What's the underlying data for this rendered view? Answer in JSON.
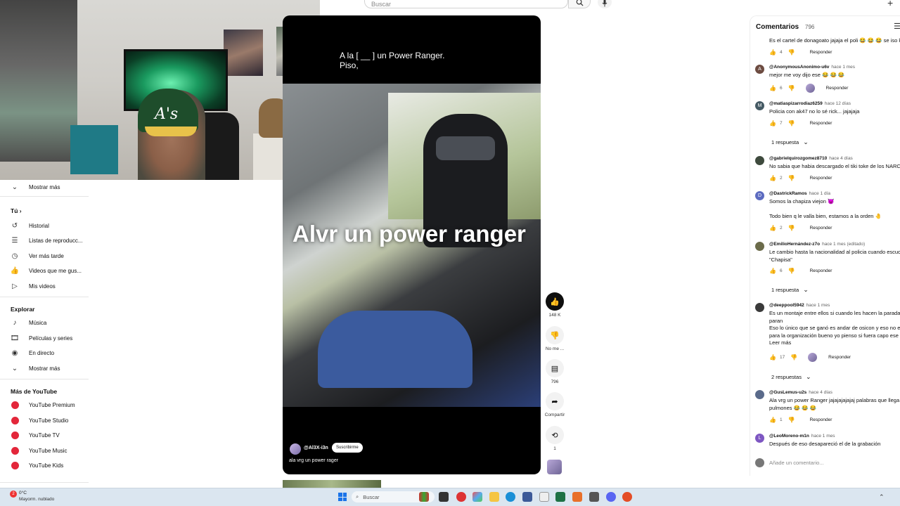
{
  "header": {
    "search_placeholder": "Buscar",
    "search_icon": "search-icon",
    "mic_icon": "mic-icon",
    "create_label": "+"
  },
  "webcam": {
    "cap_logo": "A's"
  },
  "sidebar": {
    "show_more_top": "Mostrar más",
    "you_heading": "Tú",
    "you_items": [
      {
        "label": "Historial",
        "icon": "history-icon"
      },
      {
        "label": "Listas de reproducc...",
        "icon": "playlists-icon"
      },
      {
        "label": "Ver más tarde",
        "icon": "watch-later-icon"
      },
      {
        "label": "Videos que me gus...",
        "icon": "liked-videos-icon"
      },
      {
        "label": "Mis videos",
        "icon": "my-videos-icon"
      }
    ],
    "explore_heading": "Explorar",
    "explore_items": [
      {
        "label": "Música",
        "icon": "music-icon"
      },
      {
        "label": "Películas y series",
        "icon": "movies-icon"
      },
      {
        "label": "En directo",
        "icon": "live-icon"
      },
      {
        "label": "Mostrar más",
        "icon": "chevron-down-icon"
      }
    ],
    "more_heading": "Más de YouTube",
    "more_items": [
      {
        "label": "YouTube Premium"
      },
      {
        "label": "YouTube Studio"
      },
      {
        "label": "YouTube TV"
      },
      {
        "label": "YouTube Music"
      },
      {
        "label": "YouTube Kids"
      }
    ]
  },
  "player": {
    "caption": "A la [ __ ] un Power Ranger.\nPiso,",
    "overlay_text": "Alvr  un power ranger",
    "channel": "@Al3X-i3n",
    "subscribe_label": "Suscribirme",
    "title": "ala vrg un power rager"
  },
  "actions": {
    "like_count": "148 K",
    "dislike_label": "No me ...",
    "comments_count": "796",
    "share_label": "Compartir",
    "remix_count": "1"
  },
  "comments": {
    "title": "Comentarios",
    "count": "796",
    "add_placeholder": "Añade un comentario...",
    "items": [
      {
        "author": "",
        "age": "",
        "text": "Es el cartel de donagoato jajaja el poli 😂 😂 😂 se iso k",
        "likes": "4",
        "hearted": false,
        "avatar_color": "#999"
      },
      {
        "author": "@AnonymousAnonimo-u6v",
        "age": "hace 1 mes",
        "text": "mejor me voy dijo ese 😂 😂 😂",
        "likes": "6",
        "hearted": true,
        "avatar_letter": "A",
        "avatar_color": "#6d4c41"
      },
      {
        "author": "@matiaspizarrodiaz6259",
        "age": "hace 12 días",
        "text": "Policia con ak47 no lo sé rick... jajajaja",
        "likes": "7",
        "hearted": false,
        "avatar_letter": "M",
        "avatar_color": "#455a64",
        "replies": "1 respuesta"
      },
      {
        "author": "@gabrielquirozgomez8710",
        "age": "hace 4 días",
        "text": "No sabia que habia descargado el tiki toke de los NARC",
        "likes": "2",
        "hearted": false,
        "avatar_color": "#3e4a3d"
      },
      {
        "author": "@DastrickRamos",
        "age": "hace 1 día",
        "text": "Somos la chapiza viejon 😈\n\nTodo bien q le valla bien, estamos a la orden 🤚",
        "likes": "2",
        "hearted": false,
        "avatar_letter": "D",
        "avatar_color": "#5c6bc0"
      },
      {
        "author": "@EmilioHernández-z7o",
        "age": "hace 1 mes (editado)",
        "text": "Le cambio hasta la nacionalidad al policia cuando escuc\n\"Chapisa\"",
        "likes": "6",
        "hearted": false,
        "avatar_color": "#6b6b4a",
        "replies": "1 respuesta"
      },
      {
        "author": "@deeppool5942",
        "age": "hace 1 mes",
        "text": "Es un montaje entre ellos si cuando les hacen la parada\nparan\nEso lo único que se ganó es andar de osicon y eso no es\npara la organización bueno yo pienso si fuera capo ese\nLeer más",
        "likes": "17",
        "hearted": true,
        "avatar_color": "#3a3a3a",
        "replies": "2 respuestas"
      },
      {
        "author": "@GusLemus-u2s",
        "age": "hace 4 días",
        "text": "Ala vrg un power Ranger jajajajajajaj palabras que llega\npulmones 😂 😂 😂",
        "likes": "1",
        "hearted": false,
        "avatar_color": "#5a6a8a"
      },
      {
        "author": "@LeoMoreno-m1n",
        "age": "hace 1 mes",
        "text": "Después de eso desapareció el de la grabación",
        "likes": "",
        "hearted": false,
        "avatar_letter": "L",
        "avatar_color": "#7e57c2"
      }
    ]
  },
  "comment_actions": {
    "reply_label": "Responder",
    "like_icon": "thumbs-up-icon",
    "dislike_icon": "thumbs-down-icon"
  },
  "taskbar": {
    "weather_badge": "2",
    "weather_temp": "0°C",
    "weather_desc": "Mayorm. nublado",
    "search_label": "Buscar"
  }
}
